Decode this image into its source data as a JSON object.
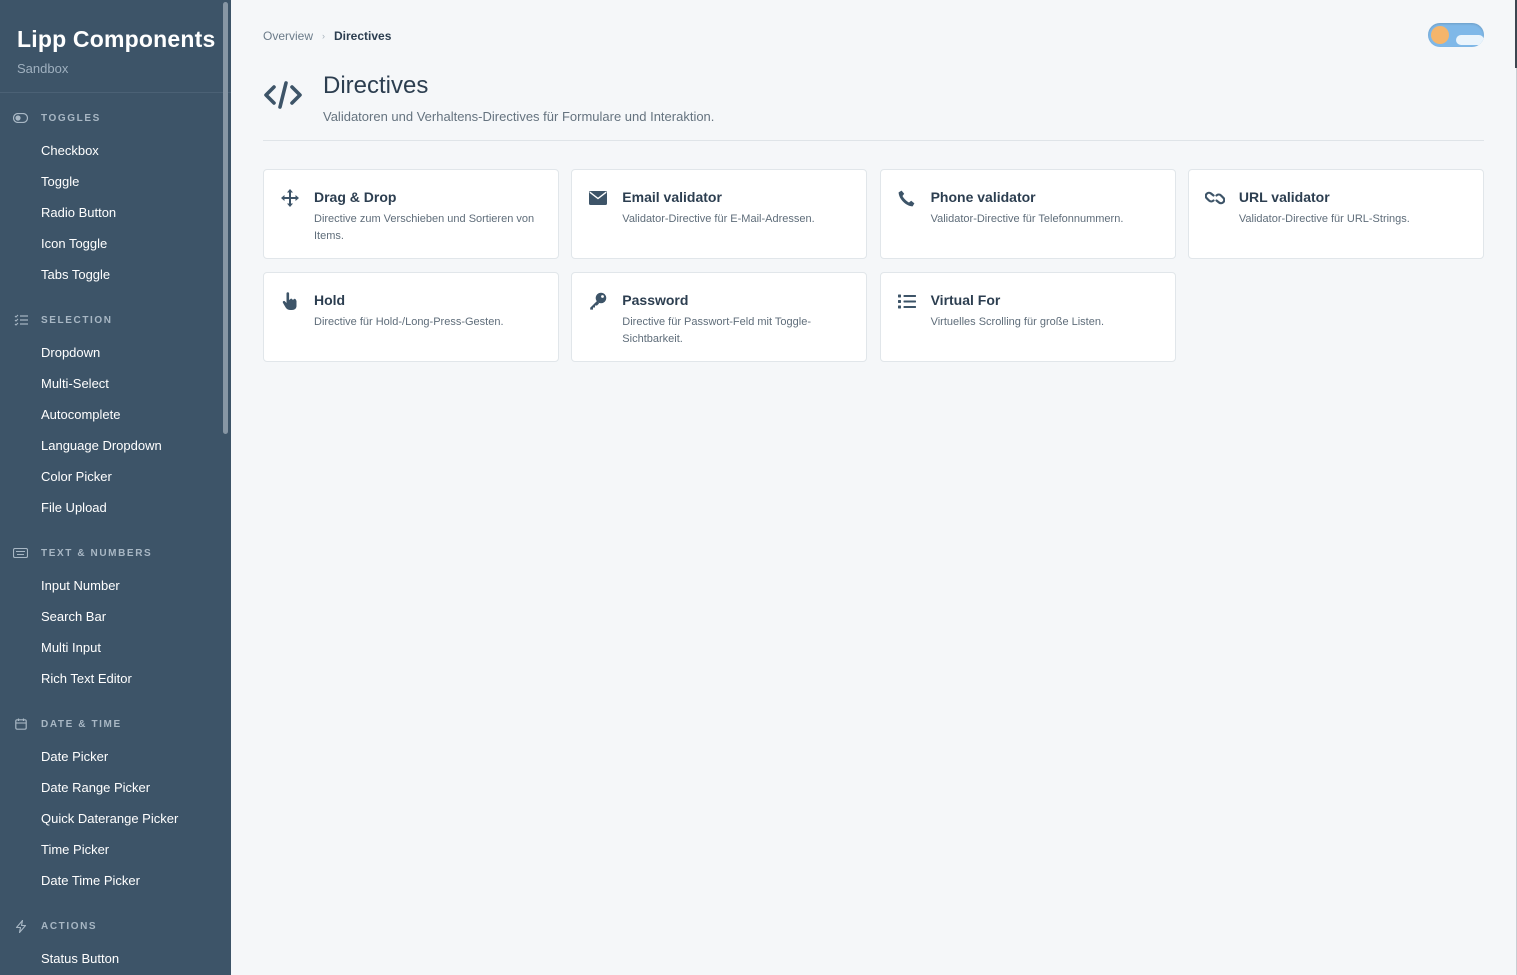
{
  "brand": {
    "title": "Lipp Components",
    "subtitle": "Sandbox"
  },
  "sidebar": {
    "sections": [
      {
        "title": "TOGGLES",
        "icon": "toggle-icon",
        "items": [
          "Checkbox",
          "Toggle",
          "Radio Button",
          "Icon Toggle",
          "Tabs Toggle"
        ]
      },
      {
        "title": "SELECTION",
        "icon": "list-check-icon",
        "items": [
          "Dropdown",
          "Multi-Select",
          "Autocomplete",
          "Language Dropdown",
          "Color Picker",
          "File Upload"
        ]
      },
      {
        "title": "TEXT & NUMBERS",
        "icon": "keyboard-icon",
        "items": [
          "Input Number",
          "Search Bar",
          "Multi Input",
          "Rich Text Editor"
        ]
      },
      {
        "title": "DATE & TIME",
        "icon": "calendar-icon",
        "items": [
          "Date Picker",
          "Date Range Picker",
          "Quick Daterange Picker",
          "Time Picker",
          "Date Time Picker"
        ]
      },
      {
        "title": "ACTIONS",
        "icon": "bolt-icon",
        "items": [
          "Status Button"
        ]
      }
    ]
  },
  "breadcrumb": {
    "parent": "Overview",
    "separator": "›",
    "current": "Directives"
  },
  "page": {
    "title": "Directives",
    "subtitle": "Validatoren und Verhaltens-Directives für Formulare und Interaktion.",
    "icon": "code-icon"
  },
  "cards": [
    {
      "title": "Drag & Drop",
      "desc": "Directive zum Verschieben und Sortieren von Items.",
      "icon": "move-icon"
    },
    {
      "title": "Email validator",
      "desc": "Validator-Directive für E-Mail-Adressen.",
      "icon": "envelope-icon"
    },
    {
      "title": "Phone validator",
      "desc": "Validator-Directive für Telefonnummern.",
      "icon": "phone-icon"
    },
    {
      "title": "URL validator",
      "desc": "Validator-Directive für URL-Strings.",
      "icon": "link-icon"
    },
    {
      "title": "Hold",
      "desc": "Directive für Hold-/Long-Press-Gesten.",
      "icon": "hand-pointer-icon"
    },
    {
      "title": "Password",
      "desc": "Directive für Passwort-Feld mit Toggle-Sichtbarkeit.",
      "icon": "key-icon"
    },
    {
      "title": "Virtual For",
      "desc": "Virtuelles Scrolling für große Listen.",
      "icon": "list-icon"
    }
  ],
  "theme_toggle": {
    "state": "light"
  },
  "colors": {
    "sidebar_bg": "#3d5468",
    "page_bg": "#f5f7f9",
    "text": "#2c3e50"
  }
}
